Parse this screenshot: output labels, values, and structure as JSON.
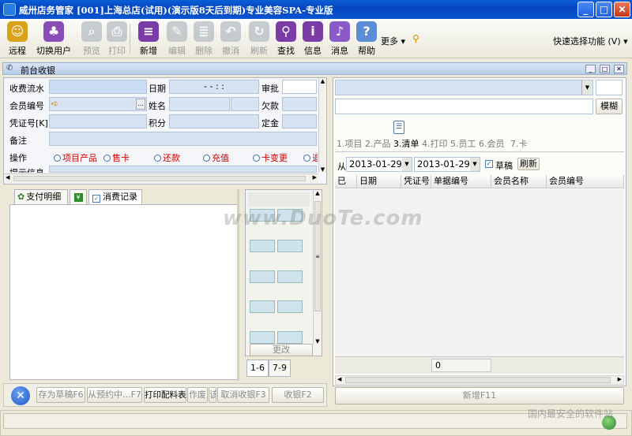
{
  "window": {
    "title": "威卅店务管家    [001]上海总店(试用)(演示版8天后到期)专业美容SPA-专业版",
    "min": "_",
    "max": "□",
    "close": "✕"
  },
  "toolbar": {
    "items": [
      {
        "label": "远程",
        "icon": "remote-icon",
        "color": "#d9a21a",
        "glyph": "☺",
        "enabled": true
      },
      {
        "label": "切换用户",
        "icon": "switch-user-icon",
        "color": "#8a4db8",
        "glyph": "♣",
        "enabled": true
      },
      {
        "label": "预览",
        "icon": "preview-icon",
        "color": "#8d9aa8",
        "glyph": "⌕",
        "enabled": false
      },
      {
        "label": "打印",
        "icon": "print-icon",
        "color": "#8d9aa8",
        "glyph": "⎙",
        "enabled": false
      },
      {
        "label": "新增",
        "icon": "add-icon",
        "color": "#7b3ca8",
        "glyph": "≡",
        "enabled": true
      },
      {
        "label": "编辑",
        "icon": "edit-icon",
        "color": "#8d9aa8",
        "glyph": "✎",
        "enabled": false
      },
      {
        "label": "删除",
        "icon": "delete-icon",
        "color": "#8d9aa8",
        "glyph": "≣",
        "enabled": false
      },
      {
        "label": "撤消",
        "icon": "undo-icon",
        "color": "#8d9aa8",
        "glyph": "↶",
        "enabled": false
      },
      {
        "label": "刷新",
        "icon": "refresh-icon",
        "color": "#8d9aa8",
        "glyph": "↻",
        "enabled": false
      },
      {
        "label": "查找",
        "icon": "find-icon",
        "color": "#7b3ca8",
        "glyph": "⚲",
        "enabled": true
      },
      {
        "label": "信息",
        "icon": "info-icon",
        "color": "#7b3ca8",
        "glyph": "i",
        "enabled": true
      },
      {
        "label": "消息",
        "icon": "message-icon",
        "color": "#8a5ac8",
        "glyph": "♪",
        "enabled": true
      },
      {
        "label": "帮助",
        "icon": "help-icon",
        "color": "#5a8cd8",
        "glyph": "?",
        "enabled": true
      }
    ],
    "more_label": "更多",
    "quick_label": "快速选择功能 (V)"
  },
  "section_title": "前台收银",
  "form": {
    "serial_label": "收费流水",
    "date_label": "日期",
    "date_value": "-  -     :  :",
    "approve_label": "审批",
    "member_label": "会员编号",
    "name_label": "姓名",
    "owe_label": "欠款",
    "voucher_label": "凭证号[K]",
    "points_label": "积分",
    "deposit_label": "定金",
    "remark_label": "备注",
    "op_label": "操作",
    "hint_label": "提示信息",
    "ops": [
      {
        "label": "项目产品",
        "red": true
      },
      {
        "label": "售卡",
        "red": true
      },
      {
        "label": "还款",
        "red": true
      },
      {
        "label": "充值",
        "red": true
      },
      {
        "label": "卡变更",
        "red": true
      },
      {
        "label": "退",
        "red": true
      }
    ]
  },
  "left_tabs": [
    "支付明细",
    "",
    "消费记录"
  ],
  "mid_panel": {
    "change_btn": "更改",
    "tabs": [
      "1-6",
      "7-9"
    ]
  },
  "right": {
    "fuzzy_btn": "模糊",
    "steps": [
      {
        "label": "1.项目",
        "active": false
      },
      {
        "label": "2.产品",
        "active": false
      },
      {
        "label": "3.清单",
        "active": true
      },
      {
        "label": "4.打印",
        "active": false
      },
      {
        "label": "5.员工",
        "active": false
      },
      {
        "label": "6.会员",
        "active": false
      },
      {
        "label": "7.卡",
        "active": false
      }
    ],
    "from_label": "从",
    "date_from": "2013-01-29",
    "date_to": "2013-01-29",
    "draft_label": "草稿",
    "refresh_btn": "刷新",
    "columns": [
      "已",
      "日期",
      "凭证号",
      "单据编号",
      "会员名称",
      "会员编号"
    ],
    "footer_value": "0",
    "new_btn": "新增F11"
  },
  "bottom_buttons": [
    {
      "label": "存为草稿F6",
      "enabled": false
    },
    {
      "label": "从预约中...F7",
      "enabled": false
    },
    {
      "label": "打印配料表",
      "enabled": true
    },
    {
      "label": "作废",
      "enabled": false
    },
    {
      "label": "该",
      "enabled": false
    },
    {
      "label": "取消收银F3",
      "enabled": false
    },
    {
      "label": "收银F2",
      "enabled": false
    }
  ],
  "watermark": "www.DuoTe.com",
  "watermark2": "国内最安全的软件站"
}
